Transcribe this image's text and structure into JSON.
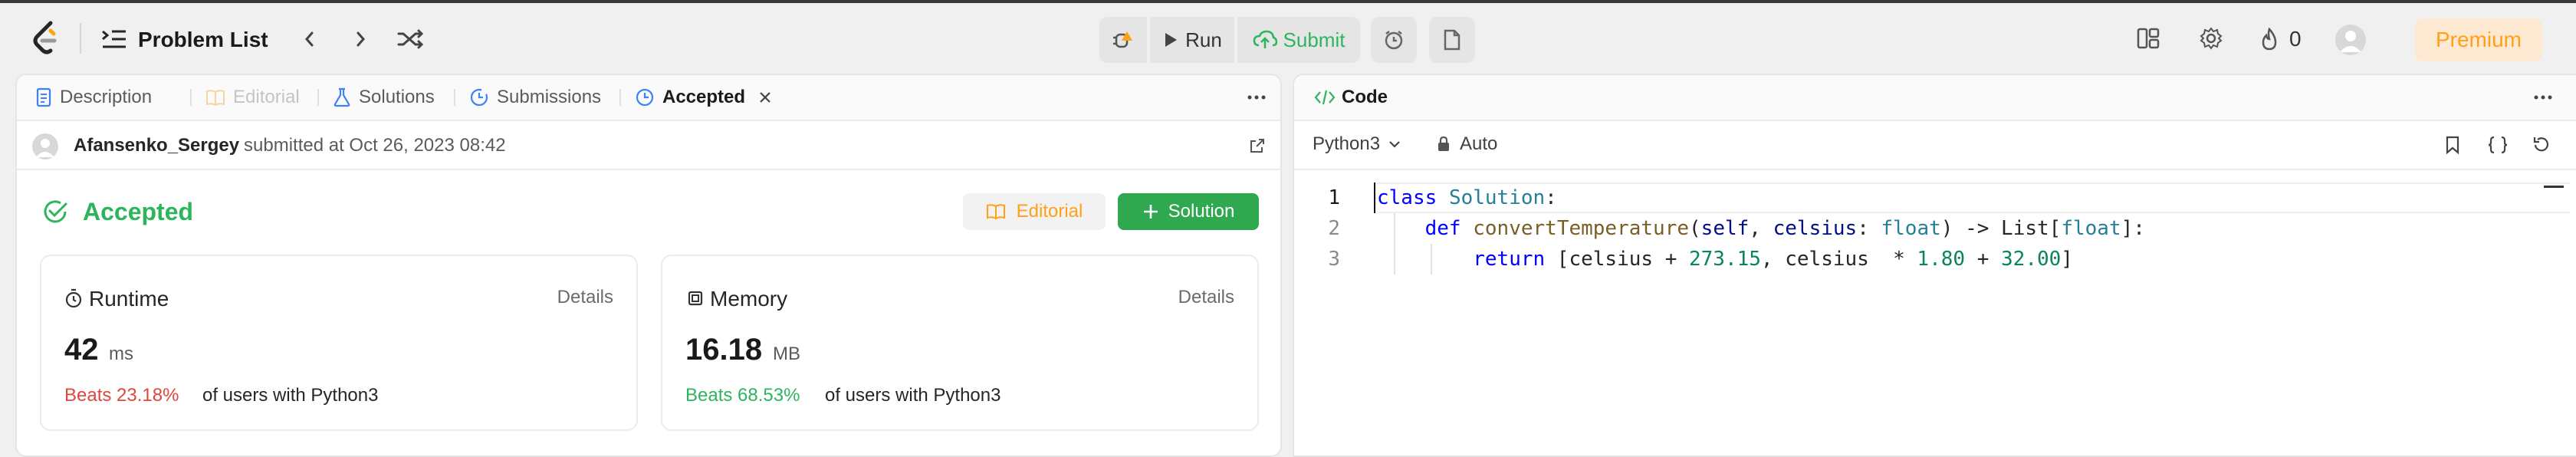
{
  "topbar": {
    "problem_list_label": "Problem List",
    "run_label": "Run",
    "submit_label": "Submit",
    "streak_count": "0",
    "premium_label": "Premium"
  },
  "left_panel": {
    "tabs": [
      {
        "label": "Description",
        "icon": "description-icon"
      },
      {
        "label": "Editorial",
        "icon": "book-icon"
      },
      {
        "label": "Solutions",
        "icon": "flask-icon"
      },
      {
        "label": "Submissions",
        "icon": "history-icon"
      },
      {
        "label": "Accepted",
        "icon": "clock-check-icon"
      }
    ],
    "submission": {
      "username": "Afansenko_Sergey",
      "submitted_text": "submitted at Oct 26, 2023 08:42"
    },
    "status": "Accepted",
    "editorial_button": "Editorial",
    "solution_button": "Solution",
    "runtime": {
      "title": "Runtime",
      "details": "Details",
      "value": "42",
      "unit": "ms",
      "beats": "Beats 23.18%",
      "suffix": "of users with Python3"
    },
    "memory": {
      "title": "Memory",
      "details": "Details",
      "value": "16.18",
      "unit": "MB",
      "beats": "Beats 68.53%",
      "suffix": "of users with Python3"
    }
  },
  "right_panel": {
    "title": "Code",
    "language": "Python3",
    "auto_label": "Auto",
    "line_numbers": [
      "1",
      "2",
      "3"
    ]
  },
  "colors": {
    "accepted_green": "#2db55d",
    "beats_red": "#e0463c",
    "premium_orange": "#ffa116",
    "solution_btn": "#2fa84f"
  }
}
